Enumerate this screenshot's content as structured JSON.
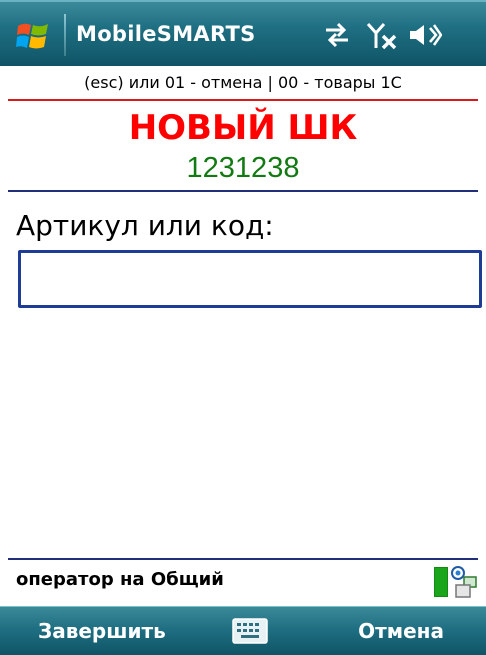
{
  "titlebar": {
    "app_title": "MobileSMARTS",
    "icons": [
      "windows-start-icon",
      "connectivity-icon",
      "signal-off-icon",
      "volume-icon"
    ]
  },
  "header": {
    "hint": "(esc) или 01 - отмена | 00 - товары 1С",
    "status_title": "НОВЫЙ ШК",
    "barcode": "1231238"
  },
  "form": {
    "label": "Артикул или код:",
    "input_value": ""
  },
  "footer": {
    "operator": "оператор на Общий"
  },
  "softkeys": {
    "left": "Завершить",
    "right": "Отмена"
  },
  "colors": {
    "bar_teal": "#1f6f82",
    "title_red": "#ff0000",
    "barcode_green": "#127a12",
    "divider_blue": "#1f2f7a"
  }
}
